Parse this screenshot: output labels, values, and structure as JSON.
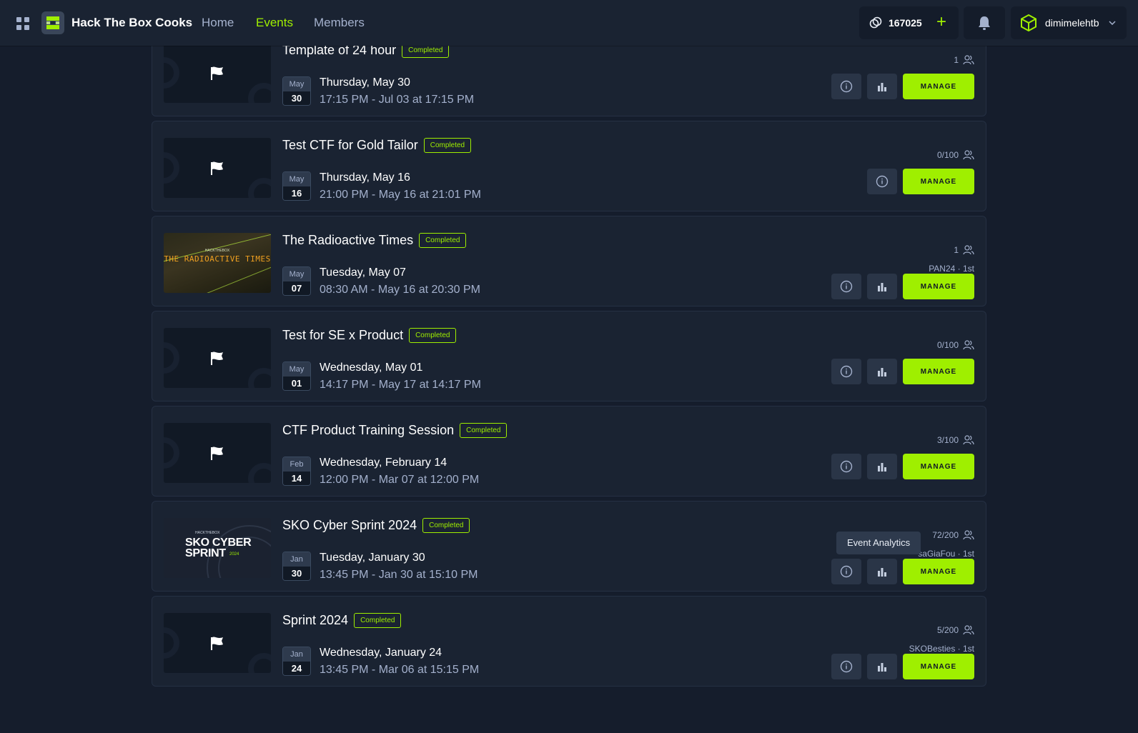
{
  "nav": {
    "brand": "Hack The Box Cooks",
    "links": [
      "Home",
      "Events",
      "Members"
    ],
    "active": "Events",
    "points": "167025",
    "username": "dimimelehtb"
  },
  "accent_color": "#9fef00",
  "manage_label": "MANAGE",
  "tooltip": "Event Analytics",
  "events": [
    {
      "title": "Template of 24 hour",
      "status": "Completed",
      "month": "May",
      "date": "30",
      "day": "Thursday, May 30",
      "range": "17:15 PM - Jul 03 at 17:15 PM",
      "participants": "1",
      "rank": "",
      "thumb": "flag",
      "analytics": true
    },
    {
      "title": "Test CTF for Gold Tailor",
      "status": "Completed",
      "month": "May",
      "date": "16",
      "day": "Thursday, May 16",
      "range": "21:00 PM - May 16 at 21:01 PM",
      "participants": "0/100",
      "rank": "",
      "thumb": "flag",
      "analytics": false
    },
    {
      "title": "The Radioactive Times",
      "status": "Completed",
      "month": "May",
      "date": "07",
      "day": "Tuesday, May 07",
      "range": "08:30 AM - May 16 at 20:30 PM",
      "participants": "1",
      "rank": "PAN24 · 1st",
      "thumb": "radioactive",
      "thumb_text": "THE RADIOACTIVE TIMES",
      "thumb_brand": "HACKTHEBOX",
      "analytics": true
    },
    {
      "title": "Test for SE x Product",
      "status": "Completed",
      "month": "May",
      "date": "01",
      "day": "Wednesday, May 01",
      "range": "14:17 PM - May 17 at 14:17 PM",
      "participants": "0/100",
      "rank": "",
      "thumb": "flag",
      "analytics": true
    },
    {
      "title": "CTF Product Training Session",
      "status": "Completed",
      "month": "Feb",
      "date": "14",
      "day": "Wednesday, February 14",
      "range": "12:00 PM - Mar 07 at 12:00 PM",
      "participants": "3/100",
      "rank": "",
      "thumb": "flag",
      "analytics": true
    },
    {
      "title": "SKO Cyber Sprint 2024",
      "status": "Completed",
      "month": "Jan",
      "date": "30",
      "day": "Tuesday, January 30",
      "range": "13:45 PM - Jan 30 at 15:10 PM",
      "participants": "72/200",
      "rank": "saGiaFou · 1st",
      "thumb": "sko",
      "thumb_text": "SKO CYBER SPRINT",
      "thumb_year": "2024",
      "thumb_brand": "HACKTHEBOX",
      "analytics": true
    },
    {
      "title": "Sprint 2024",
      "status": "Completed",
      "month": "Jan",
      "date": "24",
      "day": "Wednesday, January 24",
      "range": "13:45 PM - Mar 06 at 15:15 PM",
      "participants": "5/200",
      "rank": "SKOBesties · 1st",
      "thumb": "flag",
      "analytics": true
    }
  ]
}
